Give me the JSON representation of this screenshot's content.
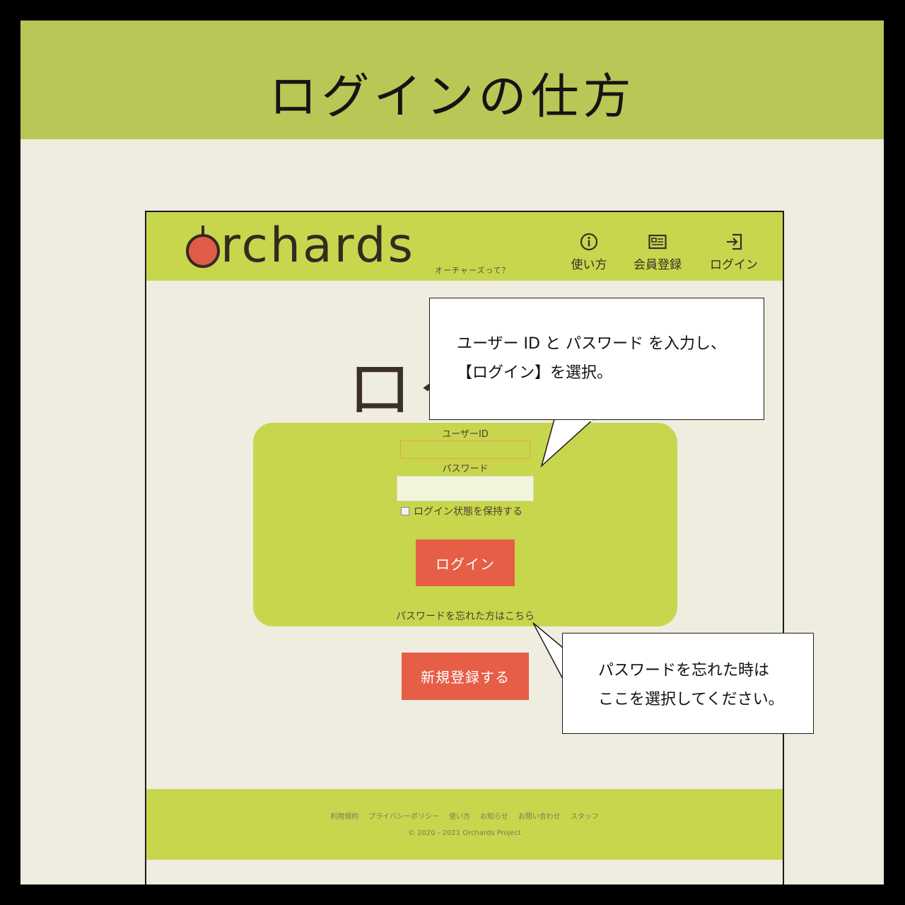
{
  "guide": {
    "title": "ログインの仕方"
  },
  "site": {
    "brand_text": "rchards",
    "about_link": "オーチャーズって？",
    "nav": {
      "howto": "使い方",
      "register": "会員登録",
      "login": "ログイン"
    }
  },
  "login": {
    "heading": "ログ",
    "userid_label": "ユーザーID",
    "userid_value": "",
    "password_label": "パスワード",
    "password_value": "",
    "remember_label": "ログイン状態を保持する",
    "remember_checked": false,
    "login_button": "ログイン",
    "forgot_link": "パスワードを忘れた方はこちら"
  },
  "register_button": "新規登録する",
  "footer": {
    "links": [
      "利用規約",
      "プライバシーポリシー",
      "使い方",
      "お知らせ",
      "お問い合わせ",
      "スタッフ"
    ],
    "copyright": "© 2020 - 2021 Orchards Project"
  },
  "callouts": {
    "login_instruction": {
      "line1": "ユーザー ID と パスワード を入力し、",
      "line2": "【ログイン】を選択。"
    },
    "forgot_instruction": {
      "line1": "パスワードを忘れた時は",
      "line2": "ここを選択してください。"
    }
  },
  "colors": {
    "guide_band": "#b9c756",
    "site_green": "#c8d64d",
    "accent_red": "#e55e45",
    "page_bg": "#eeebdf"
  }
}
